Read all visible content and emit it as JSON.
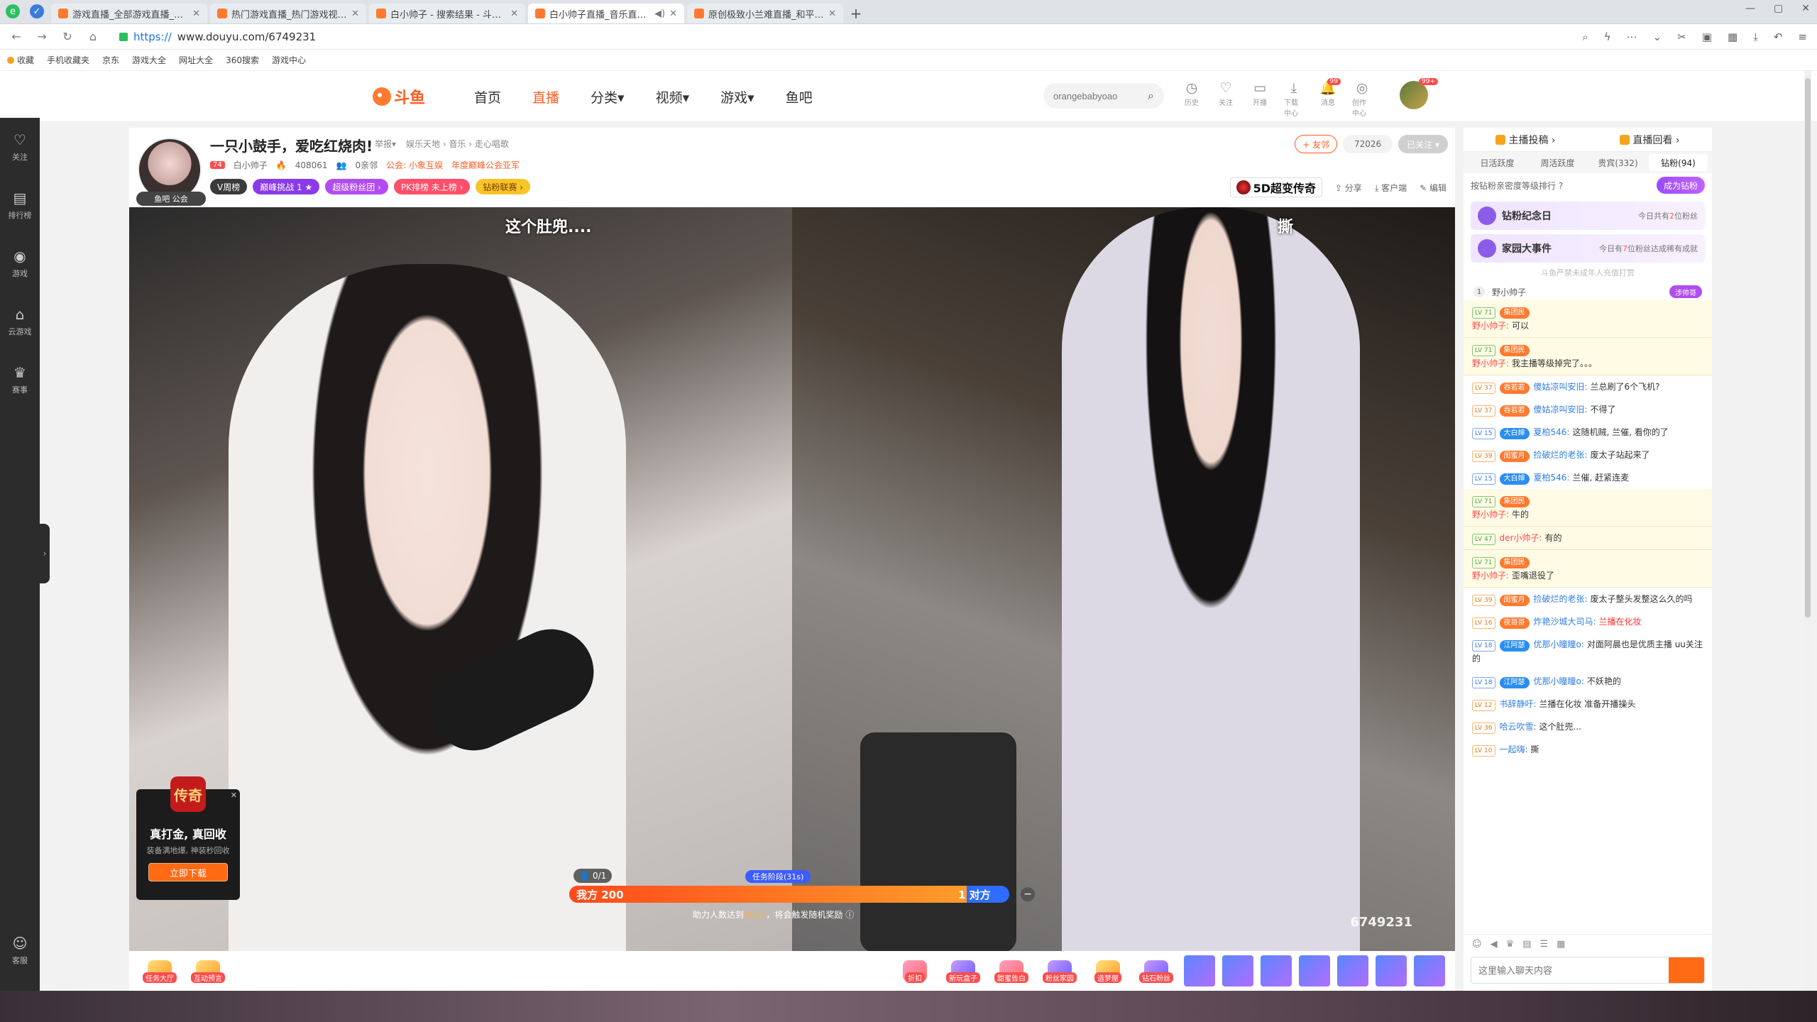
{
  "browser": {
    "tabs": [
      {
        "title": "游戏直播_全部游戏直播_斗鱼直播"
      },
      {
        "title": "热门游戏直播_热门游戏视频_斗鱼"
      },
      {
        "title": "白小帅子 - 搜索结果 - 斗鱼直播"
      },
      {
        "title": "白小帅子直播_音乐直播_斗鱼直播"
      },
      {
        "title": "原创极致小兰难直播_和平精英"
      }
    ],
    "url_scheme": "https://",
    "url_host": "www.douyu.com/6749231",
    "bookmarks": [
      "收藏",
      "手机收藏夹",
      "京东",
      "游戏大全",
      "网址大全",
      "360搜索",
      "游戏中心"
    ]
  },
  "site": {
    "logo_text": "斗鱼",
    "nav": [
      "首页",
      "直播",
      "分类▾",
      "视频▾",
      "游戏▾",
      "鱼吧"
    ],
    "nav_active": "直播",
    "search_placeholder": "orangebabyoao",
    "header_icons": [
      {
        "name": "history-icon",
        "label": "历史",
        "glyph": "◷"
      },
      {
        "name": "follow-icon",
        "label": "关注",
        "glyph": "♡"
      },
      {
        "name": "broadcast-icon",
        "label": "开播",
        "glyph": "▭"
      },
      {
        "name": "download-icon",
        "label": "下载中心",
        "glyph": "⤓"
      },
      {
        "name": "message-icon",
        "label": "消息",
        "glyph": "🔔",
        "badge": "99"
      },
      {
        "name": "creator-icon",
        "label": "创作中心",
        "glyph": "◎"
      }
    ],
    "avatar_badge": "99+"
  },
  "leftrail": [
    {
      "name": "follow",
      "label": "关注",
      "glyph": "♡"
    },
    {
      "name": "ranking",
      "label": "排行榜",
      "glyph": "▤"
    },
    {
      "name": "games",
      "label": "游戏",
      "glyph": "◉"
    },
    {
      "name": "cloud-games",
      "label": "云游戏",
      "glyph": "⌂"
    },
    {
      "name": "events",
      "label": "赛事",
      "glyph": "♛"
    }
  ],
  "leftrail_bottom": {
    "label": "客服",
    "glyph": "☺"
  },
  "room": {
    "title": "一只小鼓手，爱吃红烧肉!",
    "report_links": [
      "举报▾",
      "娱乐天地 › 音乐 › 走心唱歌"
    ],
    "host_level": "74",
    "host_name": "白小帅子",
    "heat": "408061",
    "friends": "0亲邻",
    "guild": "公会: 小象互娱",
    "guild_award": "年度巅峰公会亚军",
    "avatar_tag": "鱼吧  公会",
    "tags": [
      "V周榜",
      "巅峰挑战 1 ★",
      "超级粉丝团 ›",
      "PK排榜 未上榜 ›",
      "钻粉联赛 ›"
    ],
    "friend_button": "+ 友邻",
    "fans_count": "72026",
    "followed_label": "已关注 ▾",
    "legend_badge": "5D超变传奇",
    "share": "分享",
    "client": "客户端",
    "edit": "编辑"
  },
  "video": {
    "caption_left": "这个肚兜....",
    "caption_right": "撕",
    "watermark_id": "6749231",
    "ad": {
      "seal": "传奇",
      "title": "真打金, 真回收",
      "desc": "装备满地爆, 神装秒回收",
      "button": "立即下载",
      "close": "✕"
    },
    "pk": {
      "count": "0/1",
      "phase": "任务阶段(31s)",
      "mine_label": "我方 200",
      "theirs_label": "1 对方",
      "mine_value": 200,
      "theirs_value": 1,
      "hint_pre": "助力人数达到",
      "hint_hl": "0/1人",
      "hint_post": "，将会触发随机奖励"
    }
  },
  "gifts": {
    "left": [
      {
        "label": "任务大厅"
      },
      {
        "label": "互动预言"
      }
    ],
    "right": [
      {
        "label": "折扣"
      },
      {
        "label": "新玩盒子"
      },
      {
        "label": "甜蜜告白"
      },
      {
        "label": "粉丝家园"
      },
      {
        "label": "造梦屋"
      },
      {
        "label": "钻石粉丝"
      }
    ]
  },
  "panel": {
    "top": [
      "主播投稿 ›",
      "直播回看 ›"
    ],
    "tabs": [
      "日活跃度",
      "周活跃度",
      "贵宾(332)",
      "钻粉(94)"
    ],
    "active_tab": "钻粉(94)",
    "rank_label": "按钻粉亲密度等级排行 ?",
    "join": "成为钻粉",
    "cards": [
      {
        "title": "钻粉纪念日",
        "sub_pre": "今日共有",
        "sub_num": "2",
        "sub_post": "位粉丝"
      },
      {
        "title": "家园大事件",
        "sub_pre": "今日有",
        "sub_num": "7",
        "sub_post": "位粉丝达成稀有成就"
      }
    ],
    "note": "斗鱼严禁未成年人充值打赏",
    "top1": {
      "rank": "1",
      "name": "野小帅子",
      "badge": "涉帅哥"
    },
    "messages": [
      {
        "lv": "LV 71",
        "fan": "集团民",
        "nick": "野小帅子:",
        "text": "可以",
        "hl": true,
        "twoLine": true
      },
      {
        "lv": "LV 71",
        "fan": "集团民",
        "nick": "野小帅子:",
        "text": "我主播等级掉完了。。。",
        "hl": true,
        "twoLine": true
      },
      {
        "lv": "LV 37",
        "fan": "吞若若",
        "nick": "傻姑凉叫安旧:",
        "text": "兰总刷了6个飞机?",
        "hl": false
      },
      {
        "lv": "LV 37",
        "fan": "吞若若",
        "nick": "傻姑凉叫安旧:",
        "text": "不得了",
        "hl": false
      },
      {
        "lv": "LV 15",
        "fan": "大白婶",
        "nick": "夏柏546:",
        "text": "这随机贼, 兰催, 看你的了",
        "hl": false,
        "blue": true
      },
      {
        "lv": "LV 39",
        "fan": "闺蜜月",
        "nick": "捡破烂的老张:",
        "text": "废太子站起来了",
        "hl": false
      },
      {
        "lv": "LV 15",
        "fan": "大白婶",
        "nick": "夏柏546:",
        "text": "兰催, 赶紧连麦",
        "hl": false,
        "blue": true
      },
      {
        "lv": "LV 71",
        "fan": "集团民",
        "nick": "野小帅子:",
        "text": "牛的",
        "hl": true,
        "twoLine": true
      },
      {
        "lv": "LV 47",
        "fan": "",
        "nick": "der小帅子:",
        "text": "有的",
        "hl": true
      },
      {
        "lv": "LV 71",
        "fan": "集团民",
        "nick": "野小帅子:",
        "text": "歪嘴退役了",
        "hl": true,
        "twoLine": true
      },
      {
        "lv": "LV 39",
        "fan": "闺蜜月",
        "nick": "捡破烂的老张:",
        "text": "废太子整头发整这么久的吗",
        "hl": false
      },
      {
        "lv": "LV 16",
        "fan": "夜哥哥",
        "nick": "炸艳沙城大司马:",
        "text": "兰播在化妆",
        "hl": false,
        "red": true
      },
      {
        "lv": "LV 18",
        "fan": "江阿瑟",
        "nick": "优那小瞳瞳o:",
        "text": "对面阿晨也是优质主播 uu关注的",
        "hl": false,
        "blue": true
      },
      {
        "lv": "LV 18",
        "fan": "江阿瑟",
        "nick": "优那小瞳瞳o:",
        "text": "不妖艳的",
        "hl": false,
        "blue": true
      },
      {
        "lv": "LV 12",
        "fan": "",
        "nick": "书辞静吁:",
        "text": "兰播在化妆 准备开播操头",
        "hl": false
      },
      {
        "lv": "LV 36",
        "fan": "",
        "nick": "哈云吹雪:",
        "text": "这个肚兜...",
        "hl": false
      },
      {
        "lv": "LV 10",
        "fan": "",
        "nick": "一起嗨:",
        "text": "撕",
        "hl": false
      }
    ],
    "input_placeholder": "这里输入聊天内容"
  }
}
